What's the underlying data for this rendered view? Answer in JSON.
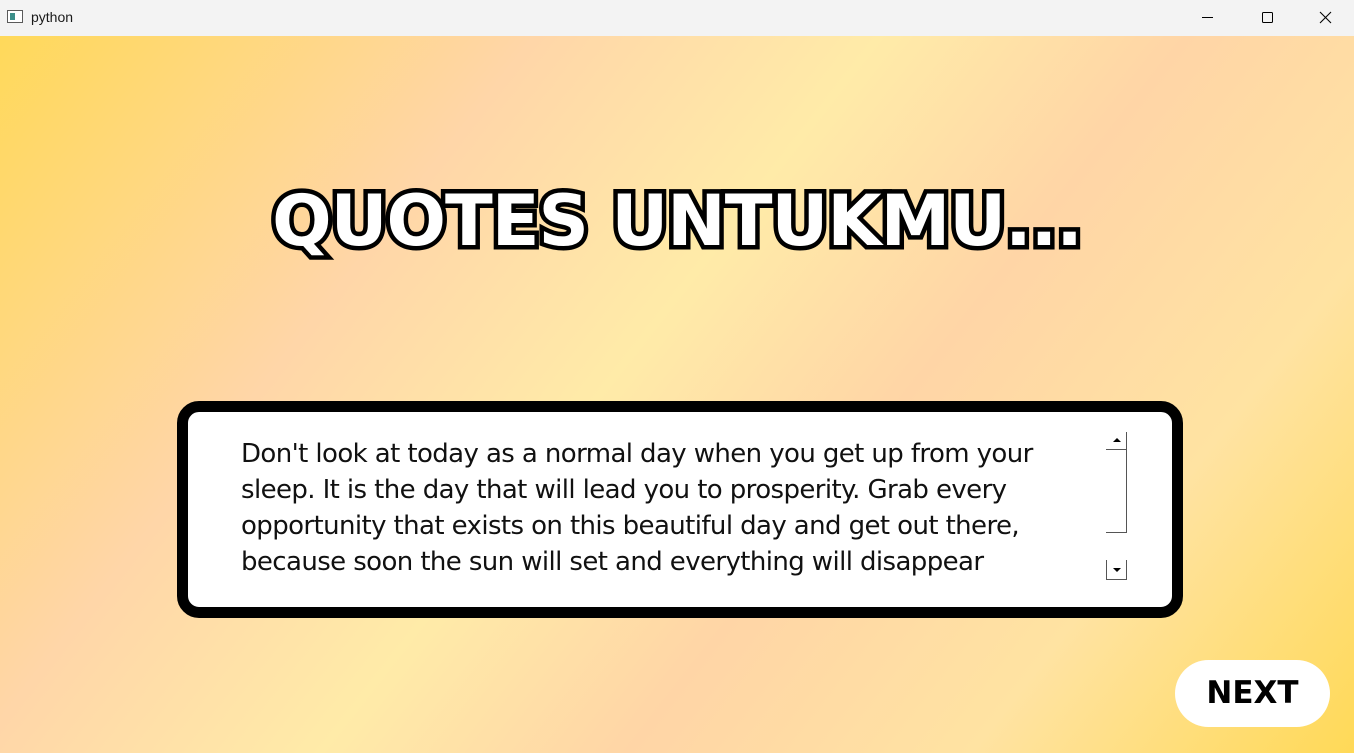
{
  "window": {
    "title": "python",
    "icons": {
      "app": "python-app-icon",
      "minimize": "minimize-icon",
      "maximize": "maximize-icon",
      "close": "close-icon"
    }
  },
  "main": {
    "heading": "QUOTES UNTUKMU...",
    "quote": "Don't look at today as a normal day when you get up from your sleep. It is the day that will lead you to prosperity. Grab every opportunity that exists on this beautiful day and get out there, because soon the sun will set and everything will disappear",
    "next_label": "NEXT"
  },
  "colors": {
    "background_gradient": [
      "#ffd95a",
      "#ffd6a8",
      "#ffeba8",
      "#ffd5a6",
      "#ffe3a2",
      "#ffd957"
    ],
    "heading_fill": "#ffffff",
    "heading_outline": "#000000",
    "quote_box_border": "#000000",
    "quote_box_fill": "#ffffff",
    "button_fill": "#ffffff",
    "text": "#000000"
  }
}
